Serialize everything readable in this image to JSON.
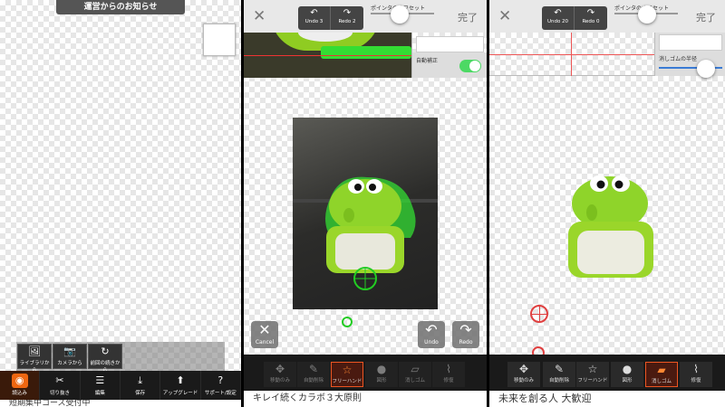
{
  "panel1": {
    "notice": "運営からのお知らせ",
    "source_buttons": [
      {
        "label": "ライブラリから",
        "icon": "image-icon"
      },
      {
        "label": "カメラから",
        "icon": "camera-icon"
      },
      {
        "label": "前回の続きから",
        "icon": "refresh-icon"
      }
    ],
    "toolbar": [
      {
        "label": "読込み",
        "icon": "camera-icon",
        "active": true
      },
      {
        "label": "切り抜き",
        "icon": "scissors-icon"
      },
      {
        "label": "編集",
        "icon": "sliders-icon"
      },
      {
        "label": "保存",
        "icon": "download-icon"
      },
      {
        "label": "アップグレード",
        "icon": "upgrade-icon"
      },
      {
        "label": "サポート/設定",
        "icon": "help-icon"
      }
    ],
    "ad_text": "短期集中コース受付中"
  },
  "panel2": {
    "undo": "Undo 3",
    "redo": "Redo 2",
    "pointer_label": "ポインタのオフセット",
    "done": "完了",
    "auto_correct": "自動補正",
    "cancel": "Cancel",
    "undo_big": "Undo",
    "redo_big": "Redo",
    "tools": [
      "移動のみ",
      "自動削除",
      "フリーハンド",
      "図形",
      "消しゴム",
      "修復"
    ],
    "ad_text": "キレイ続くカラボ３大原則"
  },
  "panel3": {
    "undo": "Undo 20",
    "redo": "Redo 0",
    "pointer_label": "ポインタのオフセット",
    "done": "完了",
    "eraser_label": "消しゴムの半径",
    "tools": [
      "移動のみ",
      "自動削除",
      "フリーハンド",
      "図形",
      "消しゴム",
      "修復"
    ],
    "ad_text": "未来を創る人 大歓迎"
  }
}
